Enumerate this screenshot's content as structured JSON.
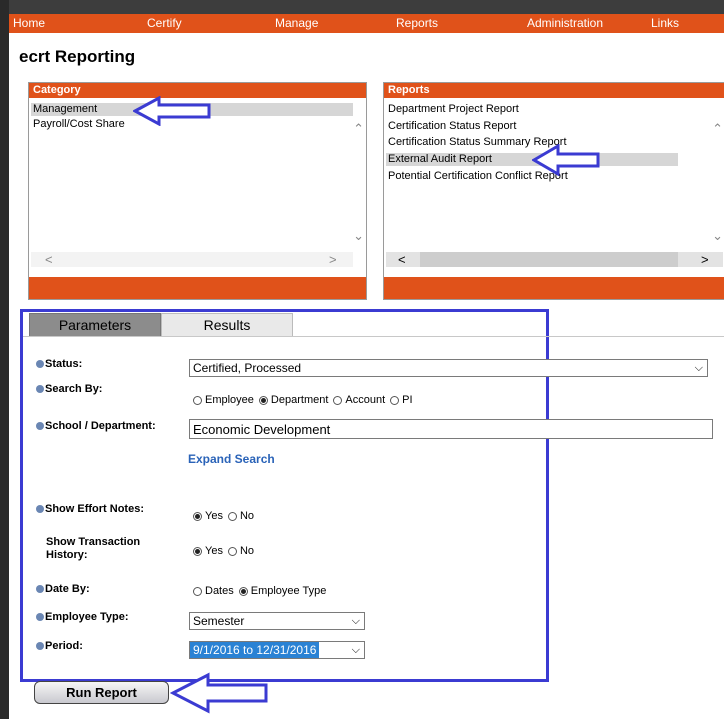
{
  "nav": {
    "items": [
      "Home",
      "Certify",
      "Manage",
      "Reports",
      "Administration",
      "Links"
    ]
  },
  "page": {
    "title": "ecrt Reporting"
  },
  "category": {
    "header": "Category",
    "items": [
      "Management",
      "Payroll/Cost Share"
    ],
    "selected": "Management"
  },
  "reports": {
    "header": "Reports",
    "items": [
      "Department Project Report",
      "Certification Status Report",
      "Certification Status Summary Report",
      "External Audit Report",
      "Potential Certification Conflict Report"
    ],
    "selected": "External Audit Report"
  },
  "tabs": {
    "parameters": "Parameters",
    "results": "Results",
    "active": "Parameters"
  },
  "form": {
    "status": {
      "label": "Status:",
      "value": "Certified, Processed"
    },
    "search_by": {
      "label": "Search By:",
      "options": [
        "Employee",
        "Department",
        "Account",
        "PI"
      ],
      "selected": "Department"
    },
    "school_department": {
      "label": "School / Department:",
      "value": "Economic Development"
    },
    "expand_search": "Expand Search",
    "show_effort_notes": {
      "label": "Show Effort Notes:",
      "options": [
        "Yes",
        "No"
      ],
      "selected": "Yes"
    },
    "show_transaction_history": {
      "label_line1": "Show Transaction",
      "label_line2": "History:",
      "options": [
        "Yes",
        "No"
      ],
      "selected": "Yes"
    },
    "date_by": {
      "label": "Date By:",
      "options": [
        "Dates",
        "Employee Type"
      ],
      "selected": "Employee Type"
    },
    "employee_type": {
      "label": "Employee Type:",
      "value": "Semester"
    },
    "period": {
      "label": "Period:",
      "value": "9/1/2016 to 12/31/2016"
    }
  },
  "run_report": "Run Report",
  "colors": {
    "accent": "#e0521a",
    "annotation": "#3b3bd2",
    "link": "#2a63b8"
  }
}
